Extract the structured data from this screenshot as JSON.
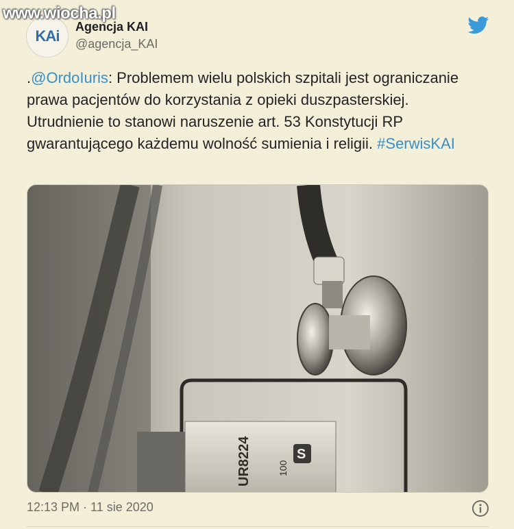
{
  "watermark": "www.wiocha.pl",
  "author": {
    "avatar_text": "KAi",
    "display_name": "Agencja KAI",
    "handle": "@agencja_KAI"
  },
  "tweet": {
    "prefix": ".",
    "mention": "@OrdoIuris",
    "body": ": Problemem wielu polskich szpitali jest ograniczanie prawa pacjentów do korzystania z opieki duszpasterskiej. Utrudnienie to stanowi naruszenie art. 53 Konstytucji RP gwarantującego każdemu wolność sumienia i religii. ",
    "hashtag": "#SerwisKAI"
  },
  "media": {
    "label_code": "UR8224",
    "label_letter": "S",
    "label_count": "100"
  },
  "meta": {
    "timestamp": "12:13 PM · 11 sie 2020"
  },
  "icons": {
    "brand": "twitter-bird-icon",
    "info": "info-icon"
  },
  "colors": {
    "link": "#3a8fc4",
    "twitter_blue": "#3a9ad9",
    "background": "#f3efd9"
  }
}
